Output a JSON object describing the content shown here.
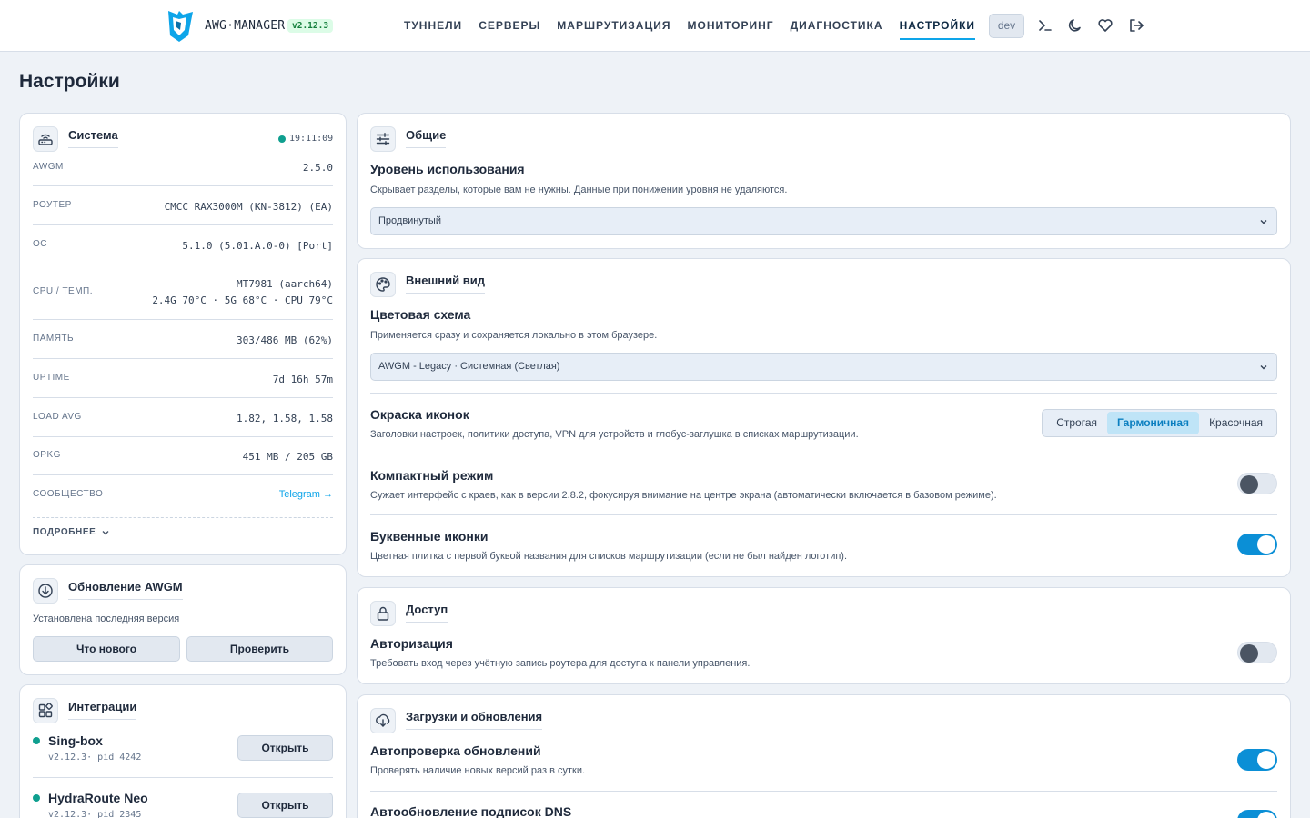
{
  "header": {
    "brand": "AWG·MANAGER",
    "version": "v2.12.3",
    "nav": [
      "ТУННЕЛИ",
      "СЕРВЕРЫ",
      "МАРШРУТИЗАЦИЯ",
      "МОНИТОРИНГ",
      "ДИАГНОСТИКА",
      "НАСТРОЙКИ"
    ],
    "active_nav": "НАСТРОЙКИ",
    "env_badge": "dev",
    "icons": [
      "terminal-icon",
      "moon-icon",
      "heart-icon",
      "logout-icon"
    ]
  },
  "page": {
    "title": "Настройки"
  },
  "system": {
    "title": "Система",
    "time": "19:11:09",
    "rows": [
      {
        "label": "AWGM",
        "value": "2.5.0"
      },
      {
        "label": "РОУТЕР",
        "value": "CMCC RAX3000M (KN-3812) (EA)"
      },
      {
        "label": "ОС",
        "value": "5.1.0 (5.01.A.0-0) [Port]"
      },
      {
        "label": "CPU / ТЕМП.",
        "value": "MT7981 (aarch64)",
        "value2": "2.4G 70°C · 5G 68°C · CPU 79°C"
      },
      {
        "label": "ПАМЯТЬ",
        "value": "303/486 MB (62%)"
      },
      {
        "label": "UPTIME",
        "value": "7d 16h 57m"
      },
      {
        "label": "LOAD AVG",
        "value": "1.82, 1.58, 1.58"
      },
      {
        "label": "OPKG",
        "value": "451 MB / 205 GB"
      },
      {
        "label": "СООБЩЕСТВО",
        "value": "Telegram →"
      }
    ],
    "more": "ПОДРОБНЕЕ"
  },
  "update": {
    "title": "Обновление AWGM",
    "status": "Установлена последняя версия",
    "whats_new": "Что нового",
    "check": "Проверить"
  },
  "integrations": {
    "title": "Интеграции",
    "items": [
      {
        "name": "Sing-box",
        "meta": "v2.12.3· pid 4242",
        "action": "Открыть"
      },
      {
        "name": "HydraRoute Neo",
        "meta": "v2.12.3· pid 2345",
        "action": "Открыть"
      }
    ]
  },
  "general": {
    "title": "Общие",
    "usage_title": "Уровень использования",
    "usage_desc": "Скрывает разделы, которые вам не нужны. Данные при понижении уровня не удаляются.",
    "usage_value": "Продвинутый"
  },
  "appearance": {
    "title": "Внешний вид",
    "scheme_title": "Цветовая схема",
    "scheme_desc": "Применяется сразу и сохраняется локально в этом браузере.",
    "scheme_value": "AWGM - Legacy · Системная (Светлая)",
    "icons_title": "Окраска иконок",
    "icons_desc": "Заголовки настроек, политики доступа, VPN для устройств и глобус-заглушка в списках маршрутизации.",
    "icons_options": [
      "Строгая",
      "Гармоничная",
      "Красочная"
    ],
    "icons_selected": "Гармоничная",
    "compact_title": "Компактный режим",
    "compact_desc": "Сужает интерфейс с краев, как в версии 2.8.2, фокусируя внимание на центре экрана (автоматически включается в базовом режиме).",
    "compact_on": false,
    "letter_title": "Буквенные иконки",
    "letter_desc": "Цветная плитка с первой буквой названия для списков маршрутизации (если не был найден логотип).",
    "letter_on": true
  },
  "access": {
    "title": "Доступ",
    "auth_title": "Авторизация",
    "auth_desc": "Требовать вход через учётную запись роутера для доступа к панели управления.",
    "auth_on": false
  },
  "downloads": {
    "title": "Загрузки и обновления",
    "auto_check_title": "Автопроверка обновлений",
    "auto_check_desc": "Проверять наличие новых версий раз в сутки.",
    "auto_check_on": true,
    "auto_dns_title": "Автообновление подписок DNS",
    "auto_dns_on": true
  },
  "colors": {
    "accent": "#0ea5e9",
    "toggle_on": "#0b8fd6",
    "status_ok": "#0f9f8f",
    "background": "#eef2f7"
  }
}
